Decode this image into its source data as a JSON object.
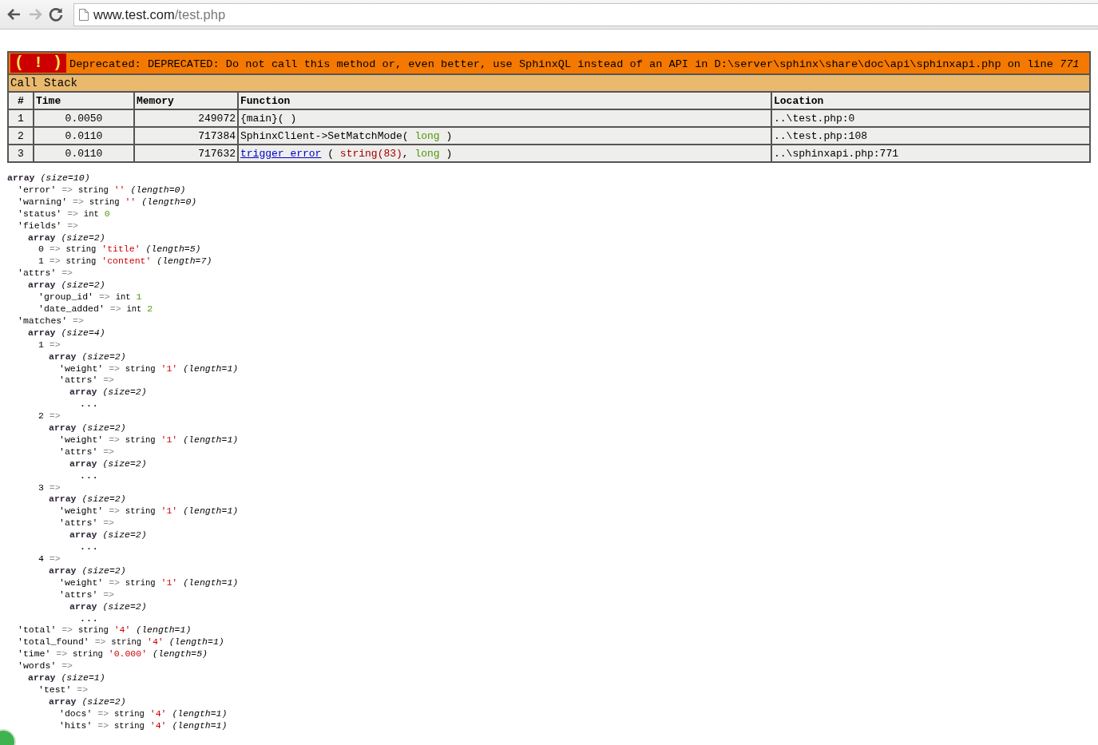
{
  "browser": {
    "url_host": "www.test.com",
    "url_path": "/test.php"
  },
  "error": {
    "badge": "( ! )",
    "message": "Deprecated: DEPRECATED: Do not call this method or, even better, use SphinxQL instead of an API in D:\\server\\sphinx\\share\\doc\\api\\sphinxapi.php on line *771*",
    "section": "Call Stack",
    "columns": [
      "#",
      "Time",
      "Memory",
      "Function",
      "Location"
    ],
    "rows": [
      {
        "index": "1",
        "time": "0.0050",
        "memory": "249072",
        "function": [
          {
            "kind": "text",
            "text": "{main}( )"
          }
        ],
        "location": "..\\test.php:0"
      },
      {
        "index": "2",
        "time": "0.0110",
        "memory": "717384",
        "function": [
          {
            "kind": "text",
            "text": "SphinxClient->SetMatchMode( "
          },
          {
            "kind": "type",
            "text": "long"
          },
          {
            "kind": "text",
            "text": " )"
          }
        ],
        "location": "..\\test.php:108"
      },
      {
        "index": "3",
        "time": "0.0110",
        "memory": "717632",
        "function": [
          {
            "kind": "link",
            "text": "trigger_error"
          },
          {
            "kind": "text",
            "text": " ( "
          },
          {
            "kind": "str",
            "text": "string(83)"
          },
          {
            "kind": "text",
            "text": ", "
          },
          {
            "kind": "type",
            "text": "long"
          },
          {
            "kind": "text",
            "text": " )"
          }
        ],
        "location": "..\\sphinxapi.php:771"
      }
    ]
  },
  "dump": {
    "parts": [
      {
        "kind": "array",
        "text": "array"
      },
      {
        "kind": "meta",
        "text": "(size=10)"
      }
    ],
    "children": [
      {
        "parts": [
          {
            "kind": "key",
            "text": "'error'"
          },
          {
            "kind": "op",
            "text": "=>"
          },
          {
            "kind": "type",
            "text": "string"
          },
          {
            "kind": "str",
            "text": "''"
          },
          {
            "kind": "meta",
            "text": "(length=0)"
          }
        ]
      },
      {
        "parts": [
          {
            "kind": "key",
            "text": "'warning'"
          },
          {
            "kind": "op",
            "text": "=>"
          },
          {
            "kind": "type",
            "text": "string"
          },
          {
            "kind": "str",
            "text": "''"
          },
          {
            "kind": "meta",
            "text": "(length=0)"
          }
        ]
      },
      {
        "parts": [
          {
            "kind": "key",
            "text": "'status'"
          },
          {
            "kind": "op",
            "text": "=>"
          },
          {
            "kind": "type",
            "text": "int"
          },
          {
            "kind": "int",
            "text": "0"
          }
        ]
      },
      {
        "parts": [
          {
            "kind": "key",
            "text": "'fields'"
          },
          {
            "kind": "op",
            "text": "=>"
          }
        ],
        "children": [
          {
            "parts": [
              {
                "kind": "array",
                "text": "array"
              },
              {
                "kind": "meta",
                "text": "(size=2)"
              }
            ],
            "children": [
              {
                "parts": [
                  {
                    "kind": "key",
                    "text": "0"
                  },
                  {
                    "kind": "op",
                    "text": "=>"
                  },
                  {
                    "kind": "type",
                    "text": "string"
                  },
                  {
                    "kind": "str",
                    "text": "'title'"
                  },
                  {
                    "kind": "meta",
                    "text": "(length=5)"
                  }
                ]
              },
              {
                "parts": [
                  {
                    "kind": "key",
                    "text": "1"
                  },
                  {
                    "kind": "op",
                    "text": "=>"
                  },
                  {
                    "kind": "type",
                    "text": "string"
                  },
                  {
                    "kind": "str",
                    "text": "'content'"
                  },
                  {
                    "kind": "meta",
                    "text": "(length=7)"
                  }
                ]
              }
            ]
          }
        ]
      },
      {
        "parts": [
          {
            "kind": "key",
            "text": "'attrs'"
          },
          {
            "kind": "op",
            "text": "=>"
          }
        ],
        "children": [
          {
            "parts": [
              {
                "kind": "array",
                "text": "array"
              },
              {
                "kind": "meta",
                "text": "(size=2)"
              }
            ],
            "children": [
              {
                "parts": [
                  {
                    "kind": "key",
                    "text": "'group_id'"
                  },
                  {
                    "kind": "op",
                    "text": "=>"
                  },
                  {
                    "kind": "type",
                    "text": "int"
                  },
                  {
                    "kind": "int",
                    "text": "1"
                  }
                ]
              },
              {
                "parts": [
                  {
                    "kind": "key",
                    "text": "'date_added'"
                  },
                  {
                    "kind": "op",
                    "text": "=>"
                  },
                  {
                    "kind": "type",
                    "text": "int"
                  },
                  {
                    "kind": "int",
                    "text": "2"
                  }
                ]
              }
            ]
          }
        ]
      },
      {
        "parts": [
          {
            "kind": "key",
            "text": "'matches'"
          },
          {
            "kind": "op",
            "text": "=>"
          }
        ],
        "children": [
          {
            "parts": [
              {
                "kind": "array",
                "text": "array"
              },
              {
                "kind": "meta",
                "text": "(size=4)"
              }
            ],
            "children": [
              {
                "parts": [
                  {
                    "kind": "key",
                    "text": "1"
                  },
                  {
                    "kind": "op",
                    "text": "=>"
                  }
                ],
                "children": [
                  {
                    "parts": [
                      {
                        "kind": "array",
                        "text": "array"
                      },
                      {
                        "kind": "meta",
                        "text": "(size=2)"
                      }
                    ],
                    "children": [
                      {
                        "parts": [
                          {
                            "kind": "key",
                            "text": "'weight'"
                          },
                          {
                            "kind": "op",
                            "text": "=>"
                          },
                          {
                            "kind": "type",
                            "text": "string"
                          },
                          {
                            "kind": "str",
                            "text": "'1'"
                          },
                          {
                            "kind": "meta",
                            "text": "(length=1)"
                          }
                        ]
                      },
                      {
                        "parts": [
                          {
                            "kind": "key",
                            "text": "'attrs'"
                          },
                          {
                            "kind": "op",
                            "text": "=>"
                          }
                        ],
                        "children": [
                          {
                            "parts": [
                              {
                                "kind": "array",
                                "text": "array"
                              },
                              {
                                "kind": "meta",
                                "text": "(size=2)"
                              }
                            ],
                            "children": [
                              {
                                "parts": [
                                  {
                                    "kind": "ellipsis",
                                    "text": "..."
                                  }
                                ]
                              }
                            ]
                          }
                        ]
                      }
                    ]
                  }
                ]
              },
              {
                "parts": [
                  {
                    "kind": "key",
                    "text": "2"
                  },
                  {
                    "kind": "op",
                    "text": "=>"
                  }
                ],
                "children": [
                  {
                    "parts": [
                      {
                        "kind": "array",
                        "text": "array"
                      },
                      {
                        "kind": "meta",
                        "text": "(size=2)"
                      }
                    ],
                    "children": [
                      {
                        "parts": [
                          {
                            "kind": "key",
                            "text": "'weight'"
                          },
                          {
                            "kind": "op",
                            "text": "=>"
                          },
                          {
                            "kind": "type",
                            "text": "string"
                          },
                          {
                            "kind": "str",
                            "text": "'1'"
                          },
                          {
                            "kind": "meta",
                            "text": "(length=1)"
                          }
                        ]
                      },
                      {
                        "parts": [
                          {
                            "kind": "key",
                            "text": "'attrs'"
                          },
                          {
                            "kind": "op",
                            "text": "=>"
                          }
                        ],
                        "children": [
                          {
                            "parts": [
                              {
                                "kind": "array",
                                "text": "array"
                              },
                              {
                                "kind": "meta",
                                "text": "(size=2)"
                              }
                            ],
                            "children": [
                              {
                                "parts": [
                                  {
                                    "kind": "ellipsis",
                                    "text": "..."
                                  }
                                ]
                              }
                            ]
                          }
                        ]
                      }
                    ]
                  }
                ]
              },
              {
                "parts": [
                  {
                    "kind": "key",
                    "text": "3"
                  },
                  {
                    "kind": "op",
                    "text": "=>"
                  }
                ],
                "children": [
                  {
                    "parts": [
                      {
                        "kind": "array",
                        "text": "array"
                      },
                      {
                        "kind": "meta",
                        "text": "(size=2)"
                      }
                    ],
                    "children": [
                      {
                        "parts": [
                          {
                            "kind": "key",
                            "text": "'weight'"
                          },
                          {
                            "kind": "op",
                            "text": "=>"
                          },
                          {
                            "kind": "type",
                            "text": "string"
                          },
                          {
                            "kind": "str",
                            "text": "'1'"
                          },
                          {
                            "kind": "meta",
                            "text": "(length=1)"
                          }
                        ]
                      },
                      {
                        "parts": [
                          {
                            "kind": "key",
                            "text": "'attrs'"
                          },
                          {
                            "kind": "op",
                            "text": "=>"
                          }
                        ],
                        "children": [
                          {
                            "parts": [
                              {
                                "kind": "array",
                                "text": "array"
                              },
                              {
                                "kind": "meta",
                                "text": "(size=2)"
                              }
                            ],
                            "children": [
                              {
                                "parts": [
                                  {
                                    "kind": "ellipsis",
                                    "text": "..."
                                  }
                                ]
                              }
                            ]
                          }
                        ]
                      }
                    ]
                  }
                ]
              },
              {
                "parts": [
                  {
                    "kind": "key",
                    "text": "4"
                  },
                  {
                    "kind": "op",
                    "text": "=>"
                  }
                ],
                "children": [
                  {
                    "parts": [
                      {
                        "kind": "array",
                        "text": "array"
                      },
                      {
                        "kind": "meta",
                        "text": "(size=2)"
                      }
                    ],
                    "children": [
                      {
                        "parts": [
                          {
                            "kind": "key",
                            "text": "'weight'"
                          },
                          {
                            "kind": "op",
                            "text": "=>"
                          },
                          {
                            "kind": "type",
                            "text": "string"
                          },
                          {
                            "kind": "str",
                            "text": "'1'"
                          },
                          {
                            "kind": "meta",
                            "text": "(length=1)"
                          }
                        ]
                      },
                      {
                        "parts": [
                          {
                            "kind": "key",
                            "text": "'attrs'"
                          },
                          {
                            "kind": "op",
                            "text": "=>"
                          }
                        ],
                        "children": [
                          {
                            "parts": [
                              {
                                "kind": "array",
                                "text": "array"
                              },
                              {
                                "kind": "meta",
                                "text": "(size=2)"
                              }
                            ],
                            "children": [
                              {
                                "parts": [
                                  {
                                    "kind": "ellipsis",
                                    "text": "..."
                                  }
                                ]
                              }
                            ]
                          }
                        ]
                      }
                    ]
                  }
                ]
              }
            ]
          }
        ]
      },
      {
        "parts": [
          {
            "kind": "key",
            "text": "'total'"
          },
          {
            "kind": "op",
            "text": "=>"
          },
          {
            "kind": "type",
            "text": "string"
          },
          {
            "kind": "str",
            "text": "'4'"
          },
          {
            "kind": "meta",
            "text": "(length=1)"
          }
        ]
      },
      {
        "parts": [
          {
            "kind": "key",
            "text": "'total_found'"
          },
          {
            "kind": "op",
            "text": "=>"
          },
          {
            "kind": "type",
            "text": "string"
          },
          {
            "kind": "str",
            "text": "'4'"
          },
          {
            "kind": "meta",
            "text": "(length=1)"
          }
        ]
      },
      {
        "parts": [
          {
            "kind": "key",
            "text": "'time'"
          },
          {
            "kind": "op",
            "text": "=>"
          },
          {
            "kind": "type",
            "text": "string"
          },
          {
            "kind": "str",
            "text": "'0.000'"
          },
          {
            "kind": "meta",
            "text": "(length=5)"
          }
        ]
      },
      {
        "parts": [
          {
            "kind": "key",
            "text": "'words'"
          },
          {
            "kind": "op",
            "text": "=>"
          }
        ],
        "children": [
          {
            "parts": [
              {
                "kind": "array",
                "text": "array"
              },
              {
                "kind": "meta",
                "text": "(size=1)"
              }
            ],
            "children": [
              {
                "parts": [
                  {
                    "kind": "key",
                    "text": "'test'"
                  },
                  {
                    "kind": "op",
                    "text": "=>"
                  }
                ],
                "children": [
                  {
                    "parts": [
                      {
                        "kind": "array",
                        "text": "array"
                      },
                      {
                        "kind": "meta",
                        "text": "(size=2)"
                      }
                    ],
                    "children": [
                      {
                        "parts": [
                          {
                            "kind": "key",
                            "text": "'docs'"
                          },
                          {
                            "kind": "op",
                            "text": "=>"
                          },
                          {
                            "kind": "type",
                            "text": "string"
                          },
                          {
                            "kind": "str",
                            "text": "'4'"
                          },
                          {
                            "kind": "meta",
                            "text": "(length=1)"
                          }
                        ]
                      },
                      {
                        "parts": [
                          {
                            "kind": "key",
                            "text": "'hits'"
                          },
                          {
                            "kind": "op",
                            "text": "=>"
                          },
                          {
                            "kind": "type",
                            "text": "string"
                          },
                          {
                            "kind": "str",
                            "text": "'4'"
                          },
                          {
                            "kind": "meta",
                            "text": "(length=1)"
                          }
                        ]
                      }
                    ]
                  }
                ]
              }
            ]
          }
        ]
      }
    ]
  }
}
